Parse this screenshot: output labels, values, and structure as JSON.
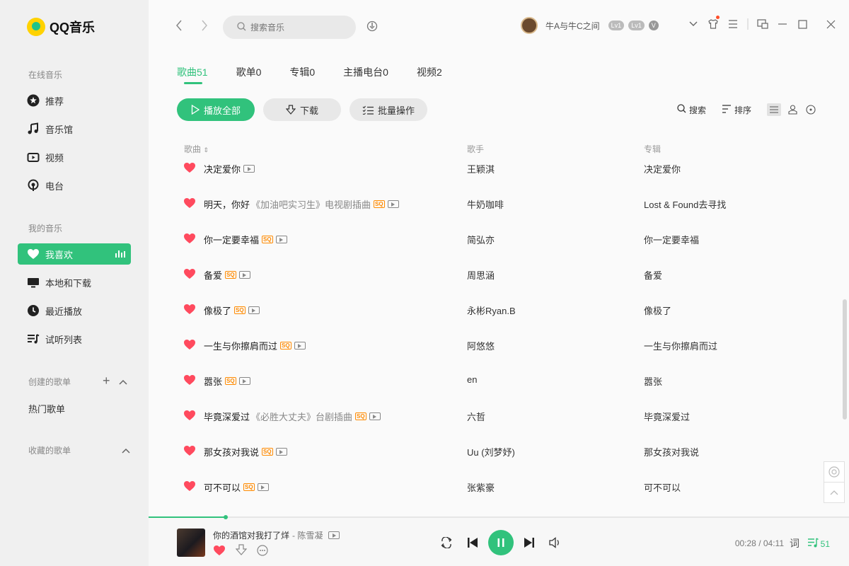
{
  "app": {
    "logo_text": "QQ音乐"
  },
  "colors": {
    "accent": "#31c27c",
    "sq_badge": "#ff8a00",
    "heart": "#ff4a5e"
  },
  "sidebar": {
    "online_title": "在线音乐",
    "online_items": [
      {
        "label": "推荐",
        "icon": "star-icon"
      },
      {
        "label": "音乐馆",
        "icon": "music-note-icon"
      },
      {
        "label": "视频",
        "icon": "video-icon"
      },
      {
        "label": "电台",
        "icon": "radio-icon"
      }
    ],
    "my_title": "我的音乐",
    "my_items": [
      {
        "label": "我喜欢",
        "icon": "heart-icon",
        "active": true
      },
      {
        "label": "本地和下载",
        "icon": "monitor-icon"
      },
      {
        "label": "最近播放",
        "icon": "clock-icon"
      },
      {
        "label": "试听列表",
        "icon": "playlist-icon"
      }
    ],
    "created_title": "创建的歌单",
    "created_items": [
      "热门歌单"
    ],
    "collected_title": "收藏的歌单"
  },
  "topbar": {
    "search_placeholder": "搜索音乐",
    "username": "牛A与牛C之间",
    "badges": [
      "Lv1",
      "Lv1",
      "V"
    ]
  },
  "tabs": [
    {
      "label": "歌曲51",
      "active": true
    },
    {
      "label": "歌单0"
    },
    {
      "label": "专辑0"
    },
    {
      "label": "主播电台0"
    },
    {
      "label": "视频2"
    }
  ],
  "actions": {
    "play_all": "播放全部",
    "download": "下载",
    "batch": "批量操作"
  },
  "tools": {
    "search": "搜索",
    "sort": "排序"
  },
  "table": {
    "headers": {
      "song": "歌曲",
      "singer": "歌手",
      "album": "专辑"
    },
    "rows": [
      {
        "title": "决定爱你",
        "sub": "",
        "sq": false,
        "mv": true,
        "singer": "王颖淇",
        "album": "决定爱你"
      },
      {
        "title": "明天，你好",
        "sub": "《加油吧实习生》电视剧插曲",
        "sq": true,
        "mv": true,
        "singer": "牛奶咖啡",
        "album": "Lost & Found去寻找"
      },
      {
        "title": "你一定要幸福",
        "sub": "",
        "sq": true,
        "mv": true,
        "singer": "简弘亦",
        "album": "你一定要幸福"
      },
      {
        "title": "备爱",
        "sub": "",
        "sq": true,
        "mv": true,
        "singer": "周思涵",
        "album": "备爱"
      },
      {
        "title": "像极了",
        "sub": "",
        "sq": true,
        "mv": true,
        "singer": "永彬Ryan.B",
        "album": "像极了"
      },
      {
        "title": "一生与你擦肩而过",
        "sub": "",
        "sq": true,
        "mv": true,
        "singer": "阿悠悠",
        "album": "一生与你擦肩而过"
      },
      {
        "title": "嚣张",
        "sub": "",
        "sq": true,
        "mv": true,
        "singer": "en",
        "album": "嚣张"
      },
      {
        "title": "毕竟深爱过",
        "sub": "《必胜大丈夫》台剧插曲",
        "sq": true,
        "mv": true,
        "singer": "六哲",
        "album": "毕竟深爱过"
      },
      {
        "title": "那女孩对我说",
        "sub": "",
        "sq": true,
        "mv": true,
        "singer": "Uu (刘梦妤)",
        "album": "那女孩对我说"
      },
      {
        "title": "可不可以",
        "sub": "",
        "sq": true,
        "mv": true,
        "singer": "张紫豪",
        "album": "可不可以"
      }
    ],
    "sq_label": "SQ"
  },
  "player": {
    "title": "你的酒馆对我打了烊",
    "artist": "- 陈雪凝",
    "time": "00:28 / 04:11",
    "progress": 0.11,
    "lyric": "词",
    "queue_count": "51"
  }
}
